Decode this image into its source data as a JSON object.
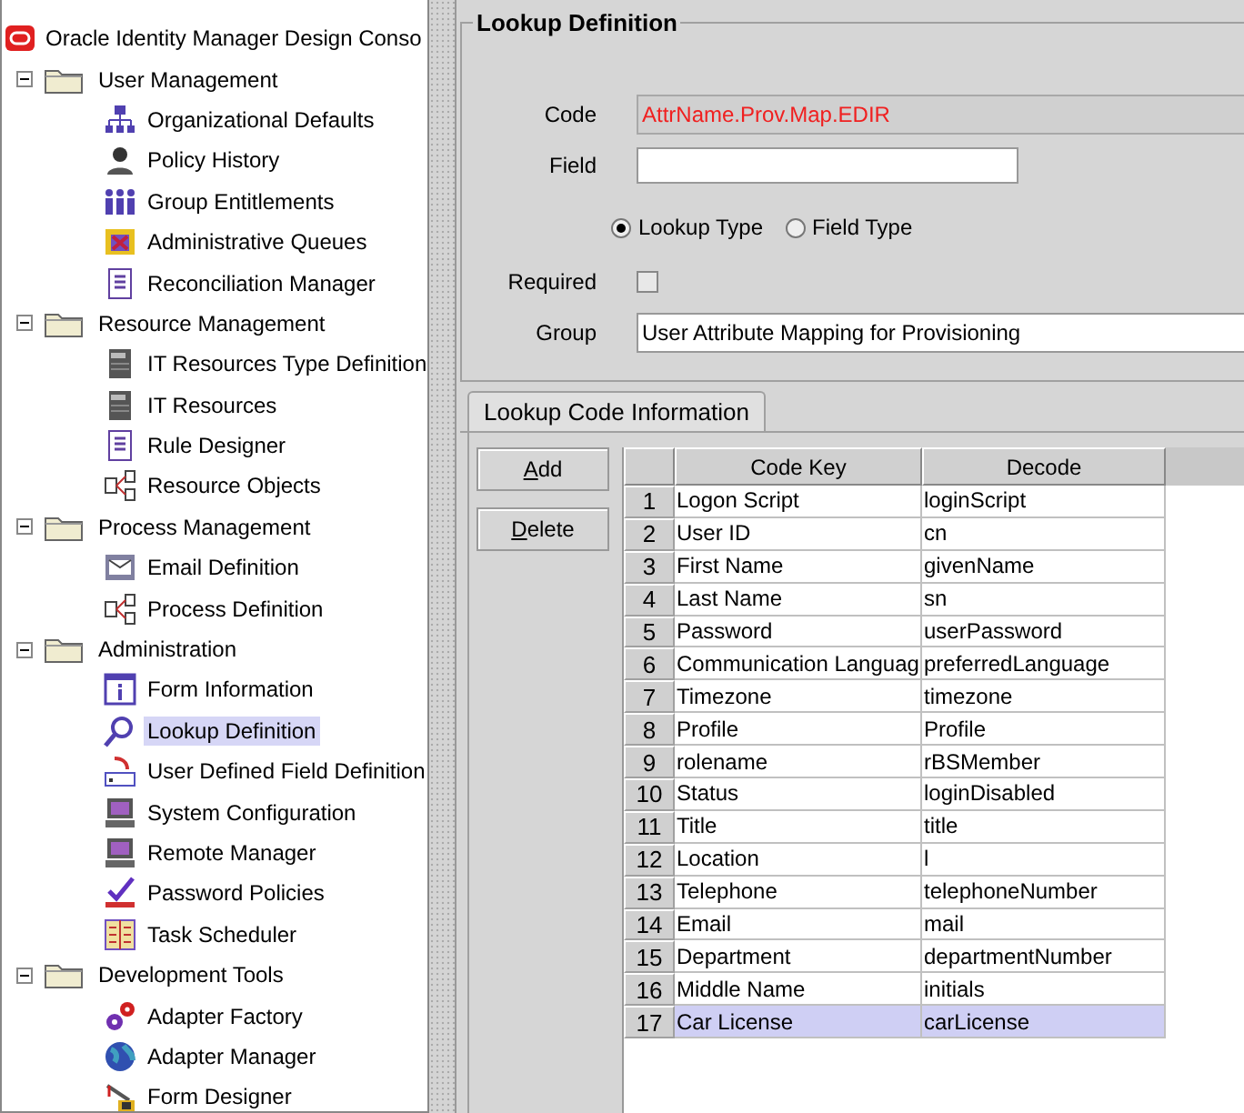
{
  "tree": {
    "title": "Oracle Identity Manager Design Conso",
    "groups": [
      {
        "label": "User Management",
        "expanded": true,
        "children": [
          {
            "label": "Organizational Defaults",
            "selected": false
          },
          {
            "label": "Policy History",
            "selected": false
          },
          {
            "label": "Group Entitlements",
            "selected": false
          },
          {
            "label": "Administrative Queues",
            "selected": false
          },
          {
            "label": "Reconciliation Manager",
            "selected": false
          }
        ]
      },
      {
        "label": "Resource Management",
        "expanded": true,
        "children": [
          {
            "label": "IT Resources Type Definition",
            "selected": false
          },
          {
            "label": "IT Resources",
            "selected": false
          },
          {
            "label": "Rule Designer",
            "selected": false
          },
          {
            "label": "Resource Objects",
            "selected": false
          }
        ]
      },
      {
        "label": "Process Management",
        "expanded": true,
        "children": [
          {
            "label": "Email Definition",
            "selected": false
          },
          {
            "label": "Process Definition",
            "selected": false
          }
        ]
      },
      {
        "label": "Administration",
        "expanded": true,
        "children": [
          {
            "label": "Form Information",
            "selected": false
          },
          {
            "label": "Lookup Definition",
            "selected": true
          },
          {
            "label": "User Defined Field Definition",
            "selected": false
          },
          {
            "label": "System Configuration",
            "selected": false
          },
          {
            "label": "Remote Manager",
            "selected": false
          },
          {
            "label": "Password Policies",
            "selected": false
          },
          {
            "label": "Task Scheduler",
            "selected": false
          }
        ]
      },
      {
        "label": "Development Tools",
        "expanded": true,
        "children": [
          {
            "label": "Adapter Factory",
            "selected": false
          },
          {
            "label": "Adapter Manager",
            "selected": false
          },
          {
            "label": "Form Designer",
            "selected": false
          }
        ]
      }
    ]
  },
  "form": {
    "title": "Lookup Definition",
    "code_label": "Code",
    "code_value": "AttrName.Prov.Map.EDIR",
    "field_label": "Field",
    "type_options": [
      {
        "label": "Lookup Type",
        "selected": true
      },
      {
        "label": "Field Type",
        "selected": false
      }
    ],
    "required_label": "Required",
    "required": false,
    "group_label": "Group",
    "group_value": "User Attribute Mapping for Provisioning"
  },
  "tabs": [
    {
      "label": "Lookup Code Information",
      "selected": true
    }
  ],
  "buttons": [
    {
      "label": "Add"
    },
    {
      "label": "Delete"
    }
  ],
  "table": {
    "columns": [
      "Code Key",
      "Decode"
    ],
    "rows": [
      {
        "num": "1",
        "key": "Logon Script",
        "decode": "loginScript",
        "selected": false
      },
      {
        "num": "2",
        "key": "User ID",
        "decode": "cn",
        "selected": false
      },
      {
        "num": "3",
        "key": "First Name",
        "decode": "givenName",
        "selected": false
      },
      {
        "num": "4",
        "key": "Last Name",
        "decode": "sn",
        "selected": false
      },
      {
        "num": "5",
        "key": "Password",
        "decode": "userPassword",
        "selected": false
      },
      {
        "num": "6",
        "key": "Communication Languag",
        "decode": "preferredLanguage",
        "selected": false
      },
      {
        "num": "7",
        "key": "Timezone",
        "decode": "timezone",
        "selected": false
      },
      {
        "num": "8",
        "key": "Profile",
        "decode": "Profile",
        "selected": false
      },
      {
        "num": "9",
        "key": "rolename",
        "decode": "rBSMember",
        "selected": false
      },
      {
        "num": "10",
        "key": "Status",
        "decode": "loginDisabled",
        "selected": false
      },
      {
        "num": "11",
        "key": "Title",
        "decode": "title",
        "selected": false
      },
      {
        "num": "12",
        "key": "Location",
        "decode": "l",
        "selected": false
      },
      {
        "num": "13",
        "key": "Telephone",
        "decode": "telephoneNumber",
        "selected": false
      },
      {
        "num": "14",
        "key": "Email",
        "decode": "mail",
        "selected": false
      },
      {
        "num": "15",
        "key": "Department",
        "decode": "departmentNumber",
        "selected": false
      },
      {
        "num": "16",
        "key": "Middle Name",
        "decode": "initials",
        "selected": false
      },
      {
        "num": "17",
        "key": "Car License",
        "decode": "carLicense",
        "selected": true
      }
    ]
  }
}
